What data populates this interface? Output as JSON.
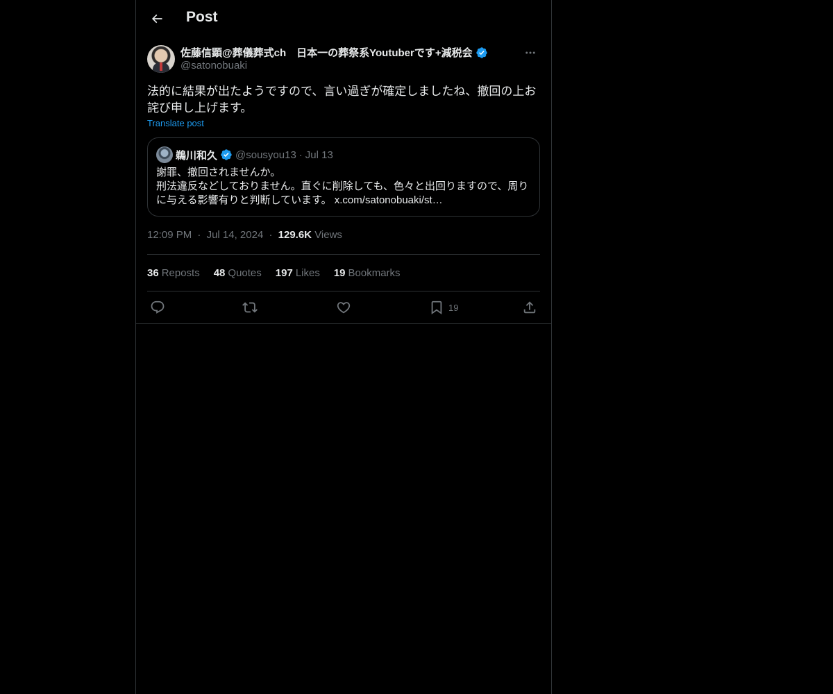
{
  "header": {
    "title": "Post"
  },
  "post": {
    "author_name": "佐藤信顕@葬儀葬式ch　日本一の葬祭系Youtuberです+減税会",
    "author_handle": "@satonobuaki",
    "text_line1": "法的に結果が出たようですので、言い過ぎが確定しましたね、撤回の上お",
    "text_line2": "詫び申し上げます。",
    "translate_label": "Translate post",
    "quote": {
      "author_name": "鵜川和久",
      "author_handle": "@sousyou13",
      "separator": "·",
      "date": "Jul 13",
      "line1": "謝罪、撤回されませんか。",
      "line2": "刑法違反などしておりません。直ぐに削除しても、色々と出回りますので、周り",
      "line3": "に与える影響有りと判断しています。 x.com/satonobuaki/st…"
    },
    "time": "12:09 PM",
    "date": "Jul 14, 2024",
    "separator": "·",
    "views_count": "129.6K",
    "views_label": "Views"
  },
  "stats": {
    "reposts_count": "36",
    "reposts_label": "Reposts",
    "quotes_count": "48",
    "quotes_label": "Quotes",
    "likes_count": "197",
    "likes_label": "Likes",
    "bookmarks_count": "19",
    "bookmarks_label": "Bookmarks"
  },
  "actions": {
    "bookmark_count": "19"
  },
  "colors": {
    "background": "#000000",
    "text": "#e7e9ea",
    "secondary": "#71767b",
    "accent": "#1d9bf0",
    "border": "#2f3336"
  },
  "icons": {
    "back": "arrow-left-icon",
    "verified": "verified-badge-icon",
    "more": "more-horizontal-icon",
    "reply": "reply-icon",
    "repost": "repost-icon",
    "like": "heart-icon",
    "bookmark": "bookmark-icon",
    "share": "share-icon"
  }
}
